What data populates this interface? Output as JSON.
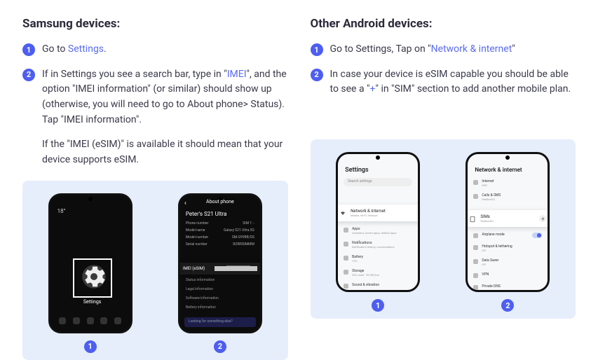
{
  "samsung": {
    "title": "Samsung devices:",
    "step1_prefix": "Go to ",
    "step1_link": "Settings",
    "step1_suffix": ".",
    "step2_prefix": "If in Settings you see a search bar, type in \"",
    "step2_link": "IMEI",
    "step2_suffix": "\", and the option \"IMEI information\" (or similar) should show up (otherwise, you will need to go to About phone> Status). Tap \"IMEI information\".",
    "step2_extra": "If the \"IMEI (eSIM)\" is available it should mean that your device supports eSIM.",
    "phone1": {
      "weather_temp": "18°",
      "settings_label": "Settings"
    },
    "phone2": {
      "title": "About phone",
      "device_name": "Peter's S21 Ultra",
      "rows": {
        "phone_no_label": "Phone number",
        "phone_no_val": "SIM 1: -",
        "model_label": "Model name",
        "model_val": "Galaxy S21 Ultra 5G",
        "model_no_label": "Model number",
        "model_no_val": "SM-G998B/DS",
        "serial_label": "Serial number",
        "serial_val": "RZ8R50MMM"
      },
      "imei_label": "IMEI (eSIM)",
      "imei_value_masked": "95████████",
      "list": {
        "status": "Status information",
        "legal": "Legal information",
        "software": "Software information",
        "battery": "Battery information"
      },
      "search_placeholder": "Looking for something else?"
    },
    "badge1": "1",
    "badge2": "2"
  },
  "android": {
    "title": "Other Android devices:",
    "step1_prefix": "Go to Settings, Tap on \"",
    "step1_link": "Network & internet",
    "step1_suffix": "\"",
    "step2_prefix": "In case your device is eSIM capable you should be able to see a \"",
    "step2_link": "+",
    "step2_suffix": "\" in \"SIM\" section to add another mobile plan.",
    "phone1": {
      "title": "Settings",
      "search": "Search settings",
      "card_title": "Network & Internet",
      "card_sub": "Mobile, Wi-Fi, hotspot",
      "rows": {
        "apps": "Apps",
        "apps_sub": "Assistant, recent apps, default apps",
        "notifications": "Notifications",
        "notifications_sub": "Notification history, conversations",
        "battery": "Battery",
        "battery_sub": "72%",
        "storage": "Storage",
        "storage_sub": "54% used · 59 GB free",
        "sound": "Sound & vibration"
      }
    },
    "phone2": {
      "title": "Network & internet",
      "rows": {
        "internet": "Internet",
        "internet_sub": "WiFi",
        "calls": "Calls & SMS",
        "calls_sub": "RedlineGO",
        "airplane": "Airplane mode",
        "hotspot": "Hotspot & tethering",
        "hotspot_sub": "Off",
        "datasaver": "Data Saver",
        "datasaver_sub": "Off",
        "vpn": "VPN",
        "private_dns": "Private DNS"
      },
      "card_title": "SIMs",
      "card_sub": "RedlineGO",
      "plus": "+"
    },
    "badge1": "1",
    "badge2": "2"
  },
  "nums": {
    "one": "1",
    "two": "2"
  }
}
